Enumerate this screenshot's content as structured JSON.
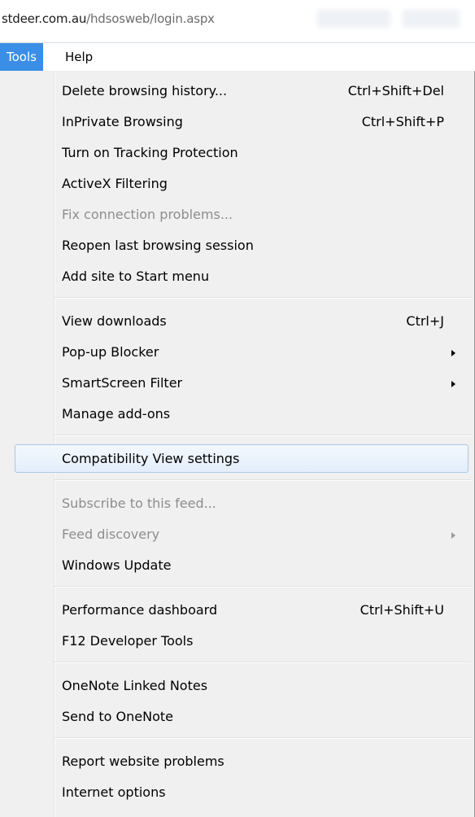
{
  "address_bar": {
    "host": "stdeer.com.au",
    "path": "/hdsosweb/login.aspx"
  },
  "menubar": {
    "items": [
      {
        "label": "Tools",
        "active": true
      },
      {
        "label": "Help",
        "active": false
      }
    ]
  },
  "tools_menu": {
    "groups": [
      [
        {
          "label": "Delete browsing history...",
          "shortcut": "Ctrl+Shift+Del"
        },
        {
          "label": "InPrivate Browsing",
          "shortcut": "Ctrl+Shift+P"
        },
        {
          "label": "Turn on Tracking Protection",
          "shortcut": ""
        },
        {
          "label": "ActiveX Filtering",
          "shortcut": ""
        },
        {
          "label": "Fix connection problems...",
          "shortcut": "",
          "disabled": true
        },
        {
          "label": "Reopen last browsing session",
          "shortcut": ""
        },
        {
          "label": "Add site to Start menu",
          "shortcut": ""
        }
      ],
      [
        {
          "label": "View downloads",
          "shortcut": "Ctrl+J"
        },
        {
          "label": "Pop-up Blocker",
          "shortcut": "",
          "submenu": true
        },
        {
          "label": "SmartScreen Filter",
          "shortcut": "",
          "submenu": true
        },
        {
          "label": "Manage add-ons",
          "shortcut": ""
        }
      ],
      [
        {
          "label": "Compatibility View settings",
          "shortcut": "",
          "hover": true
        }
      ],
      [
        {
          "label": "Subscribe to this feed...",
          "shortcut": "",
          "disabled": true
        },
        {
          "label": "Feed discovery",
          "shortcut": "",
          "disabled": true,
          "submenu": true
        },
        {
          "label": "Windows Update",
          "shortcut": ""
        }
      ],
      [
        {
          "label": "Performance dashboard",
          "shortcut": "Ctrl+Shift+U"
        },
        {
          "label": "F12 Developer Tools",
          "shortcut": ""
        }
      ],
      [
        {
          "label": "OneNote Linked Notes",
          "shortcut": ""
        },
        {
          "label": "Send to OneNote",
          "shortcut": ""
        }
      ],
      [
        {
          "label": "Report website problems",
          "shortcut": ""
        },
        {
          "label": "Internet options",
          "shortcut": ""
        }
      ]
    ]
  },
  "colors": {
    "active_menu_bg": "#3a8ee6",
    "menu_bg": "#f0f0f0",
    "disabled_text": "#8d8d8d",
    "hover_border": "#a8c8ea"
  }
}
